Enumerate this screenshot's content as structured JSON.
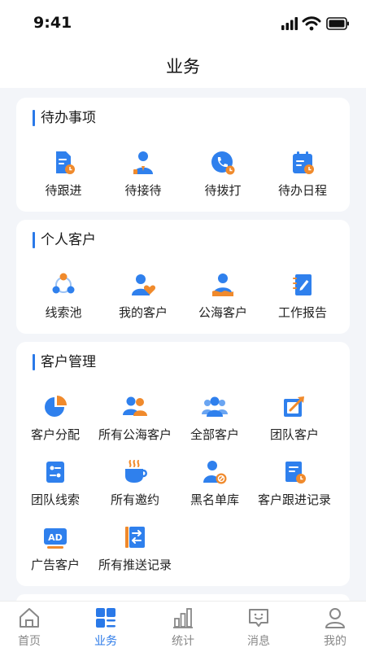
{
  "status_bar": {
    "time": "9:41"
  },
  "header": {
    "title": "业务"
  },
  "sections": [
    {
      "title": "待办事项",
      "items": [
        {
          "label": "待跟进",
          "icon": "follow-up-doc-icon"
        },
        {
          "label": "待接待",
          "icon": "reception-person-icon"
        },
        {
          "label": "待拨打",
          "icon": "phone-call-icon"
        },
        {
          "label": "待办日程",
          "icon": "calendar-schedule-icon"
        }
      ]
    },
    {
      "title": "个人客户",
      "items": [
        {
          "label": "线索池",
          "icon": "lead-pool-icon"
        },
        {
          "label": "我的客户",
          "icon": "my-customer-heart-icon"
        },
        {
          "label": "公海客户",
          "icon": "public-pool-customer-icon"
        },
        {
          "label": "工作报告",
          "icon": "work-report-icon"
        }
      ]
    },
    {
      "title": "客户管理",
      "items": [
        {
          "label": "客户分配",
          "icon": "pie-chart-icon"
        },
        {
          "label": "所有公海客户",
          "icon": "all-public-customers-icon"
        },
        {
          "label": "全部客户",
          "icon": "all-customers-group-icon"
        },
        {
          "label": "团队客户",
          "icon": "team-customer-icon"
        },
        {
          "label": "团队线索",
          "icon": "team-leads-icon"
        },
        {
          "label": "所有邀约",
          "icon": "coffee-cup-icon"
        },
        {
          "label": "黑名单库",
          "icon": "blacklist-person-icon"
        },
        {
          "label": "客户跟进记录",
          "icon": "follow-record-icon"
        },
        {
          "label": "广告客户",
          "icon": "ad-badge-icon",
          "badge_text": "AD"
        },
        {
          "label": "所有推送记录",
          "icon": "push-record-icon"
        }
      ]
    }
  ],
  "tabbar": {
    "active_index": 1,
    "tabs": [
      {
        "label": "首页",
        "icon": "home-icon"
      },
      {
        "label": "业务",
        "icon": "business-grid-icon"
      },
      {
        "label": "统计",
        "icon": "bar-chart-icon"
      },
      {
        "label": "消息",
        "icon": "message-icon"
      },
      {
        "label": "我的",
        "icon": "profile-icon"
      }
    ]
  },
  "colors": {
    "accent": "#2a79e8",
    "icon_blue": "#2f80ed",
    "icon_orange": "#f08a2c",
    "background": "#f3f5f9",
    "tab_inactive": "#888888"
  }
}
